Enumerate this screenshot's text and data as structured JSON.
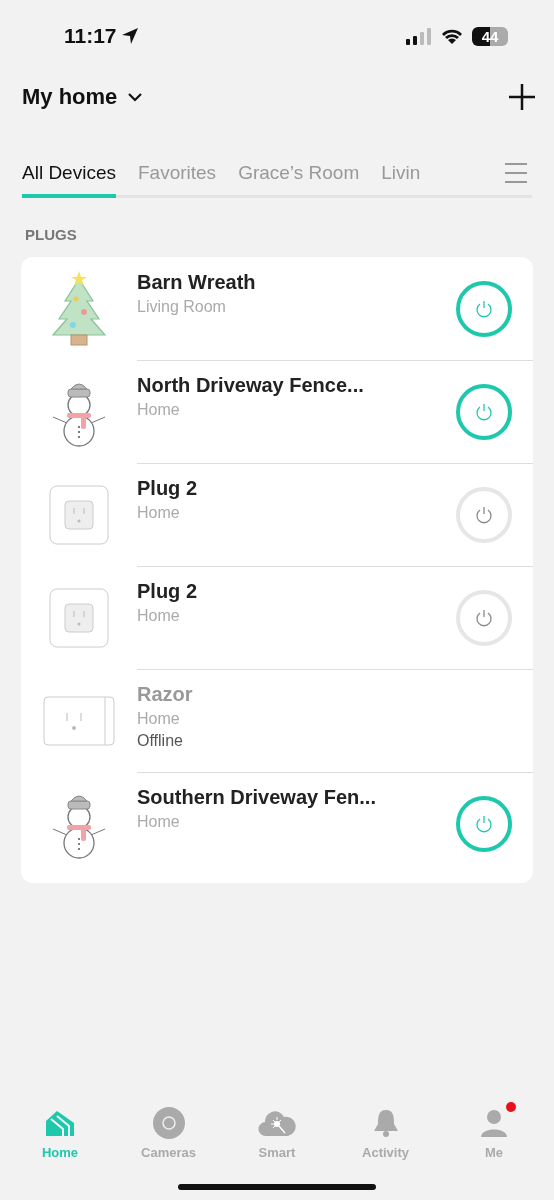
{
  "status_bar": {
    "time": "11:17",
    "battery": "44"
  },
  "header": {
    "title": "My home"
  },
  "tabs": [
    {
      "label": "All Devices",
      "selected": true
    },
    {
      "label": "Favorites",
      "selected": false
    },
    {
      "label": "Grace’s Room",
      "selected": false
    },
    {
      "label": "Livin",
      "selected": false
    }
  ],
  "section": {
    "title": "PLUGS"
  },
  "devices": [
    {
      "kind": "tree",
      "name": "Barn Wreath",
      "room": "Living Room",
      "offline": false,
      "on": true
    },
    {
      "kind": "snowman",
      "name": "North Driveway Fence...",
      "room": "Home",
      "offline": false,
      "on": true
    },
    {
      "kind": "plug",
      "name": "Plug 2",
      "room": "Home",
      "offline": false,
      "on": false
    },
    {
      "kind": "plug",
      "name": "Plug 2",
      "room": "Home",
      "offline": false,
      "on": false
    },
    {
      "kind": "plug_wide",
      "name": "Razor",
      "room": "Home",
      "offline": true,
      "status": "Offline"
    },
    {
      "kind": "snowman",
      "name": "Southern Driveway Fen...",
      "room": "Home",
      "offline": false,
      "on": true
    }
  ],
  "nav": [
    {
      "kind": "home",
      "label": "Home",
      "selected": true,
      "badge": false
    },
    {
      "kind": "camera",
      "label": "Cameras",
      "selected": false,
      "badge": false
    },
    {
      "kind": "smart",
      "label": "Smart",
      "selected": false,
      "badge": false
    },
    {
      "kind": "bell",
      "label": "Activity",
      "selected": false,
      "badge": false
    },
    {
      "kind": "person",
      "label": "Me",
      "selected": false,
      "badge": true
    }
  ]
}
